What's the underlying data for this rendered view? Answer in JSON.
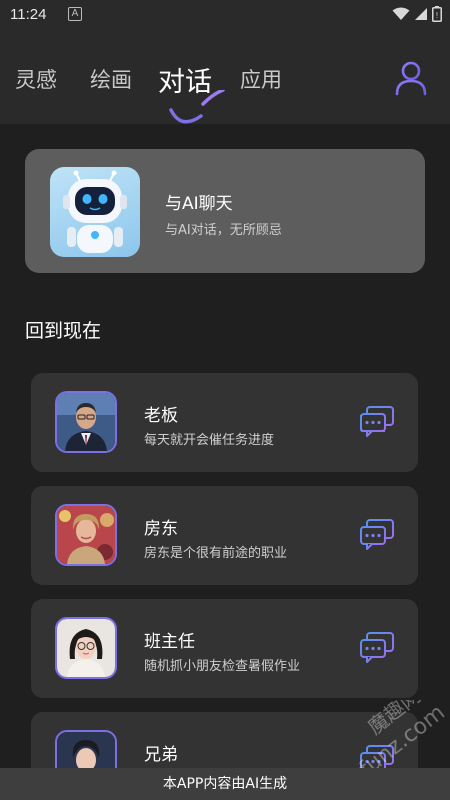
{
  "status_bar": {
    "time": "11:24",
    "notification_letter": "A"
  },
  "nav": {
    "tabs": [
      {
        "label": "灵感"
      },
      {
        "label": "绘画"
      },
      {
        "label": "对话"
      },
      {
        "label": "应用"
      }
    ],
    "active_tab": "对话",
    "accent_color": "#7d6fe6"
  },
  "feature": {
    "title": "与AI聊天",
    "subtitle": "与AI对话，无所顾忌"
  },
  "section": {
    "title": "回到现在"
  },
  "characters": [
    {
      "name": "老板",
      "desc": "每天就开会催任务进度"
    },
    {
      "name": "房东",
      "desc": "房东是个很有前途的职业"
    },
    {
      "name": "班主任",
      "desc": "随机抓小朋友检查暑假作业"
    },
    {
      "name": "兄弟",
      "desc": ""
    }
  ],
  "footer": {
    "text": "本APP内容由AI生成"
  },
  "watermark": {
    "line1": "魔趣网",
    "line2": "mfunz.com"
  }
}
